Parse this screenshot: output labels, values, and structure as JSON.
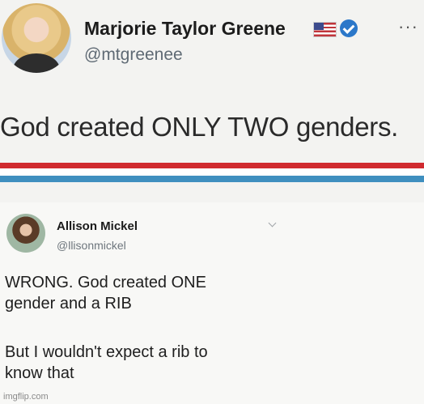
{
  "original_tweet": {
    "display_name": "Marjorie Taylor Greene",
    "handle": "@mtgreenee",
    "text": "God created ONLY TWO genders.",
    "more_label": "···",
    "icons": [
      "flag-icon",
      "verified-icon",
      "more-icon"
    ],
    "stripe_colors": [
      "#d02a2f",
      "#ffffff",
      "#3f8fbf"
    ]
  },
  "reply_tweet": {
    "display_name": "Allison Mickel",
    "handle": "@llisonmickel",
    "lines": [
      "WRONG. God created ONE",
      "gender and a RIB",
      "But I wouldn't expect a rib to",
      "know that"
    ],
    "icons": [
      "chevron-down-icon"
    ]
  },
  "watermark": "imgflip.com"
}
